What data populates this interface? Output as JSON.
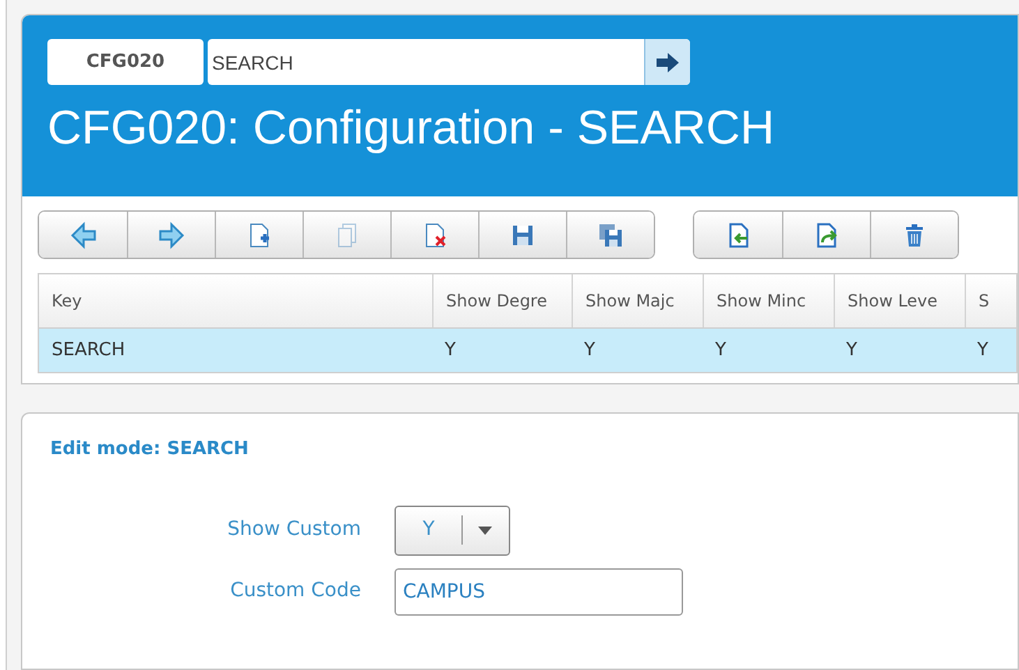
{
  "header": {
    "code_badge": "CFG020",
    "search_field": {
      "value": "SEARCH"
    },
    "title": "CFG020: Configuration - SEARCH"
  },
  "toolbar": [
    {
      "group": [
        {
          "kind": "prev",
          "disabled": false
        },
        {
          "kind": "next",
          "disabled": false
        },
        {
          "kind": "new",
          "disabled": false
        },
        {
          "kind": "copy",
          "disabled": true
        },
        {
          "kind": "delete",
          "disabled": false
        },
        {
          "kind": "save",
          "disabled": false
        },
        {
          "kind": "save-all",
          "disabled": false
        }
      ]
    },
    {
      "group": [
        {
          "kind": "import",
          "disabled": false
        },
        {
          "kind": "export",
          "disabled": false
        },
        {
          "kind": "trash",
          "disabled": false
        }
      ]
    }
  ],
  "table": {
    "columns": [
      "Key",
      "Show Degre",
      "Show Majc",
      "Show Minc",
      "Show Leve",
      "S"
    ],
    "rows": [
      {
        "cells": [
          "SEARCH",
          "Y",
          "Y",
          "Y",
          "Y",
          "Y"
        ],
        "selected": true
      }
    ]
  },
  "edit_panel": {
    "title": "Edit mode: SEARCH",
    "fields": [
      {
        "kind": "dropdown",
        "label": "Show Custom",
        "value": "Y"
      },
      {
        "kind": "text",
        "label": "Custom Code",
        "value": "CAMPUS"
      }
    ]
  }
}
